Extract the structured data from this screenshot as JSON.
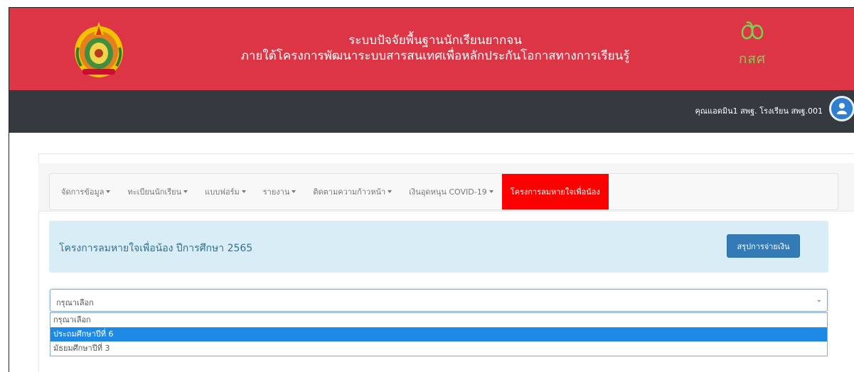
{
  "header": {
    "title_line1": "ระบบปัจจัยพื้นฐานนักเรียนยากจน",
    "title_line2": "ภายใต้โครงการพัฒนาระบบสารสนเทศเพื่อหลักประกันโอกาสทางการเรียนรู้",
    "right_logo_text": "กสศ",
    "right_logo_color": "#7cd04f"
  },
  "topbar": {
    "user_label": "คุณแอดมิน1 สพฐ. โรงเรียน สพฐ.001",
    "avatar_icon": "user-icon"
  },
  "nav": {
    "items": [
      {
        "label": "จัดการข้อมูล",
        "dropdown": true
      },
      {
        "label": "ทะเบียนนักเรียน",
        "dropdown": true
      },
      {
        "label": "แบบฟอร์ม",
        "dropdown": true
      },
      {
        "label": "รายงาน",
        "dropdown": true
      },
      {
        "label": "ติดตามความก้าวหน้า",
        "dropdown": true
      },
      {
        "label": "เงินอุดหนุน COVID-19",
        "dropdown": true
      },
      {
        "label": "โครงการลมหายใจเพื่อน้อง",
        "dropdown": false,
        "active": true
      }
    ]
  },
  "panel": {
    "title": "โครงการลมหายใจเพื่อน้อง ปีการศึกษา 2565",
    "button_label": "สรุปการจ่ายเงิน"
  },
  "select": {
    "value": "กรุณาเลือก",
    "options": [
      "กรุณาเลือก",
      "ประถมศึกษาปีที่ 6",
      "มัธยมศึกษาปีที่ 3"
    ],
    "highlighted_index": 1
  },
  "colors": {
    "header_red": "#dc3545",
    "topbar_dark": "#343a40",
    "active_tab_red": "#ff0000",
    "panel_blue": "#d9edf7",
    "button_blue": "#337ab7",
    "option_highlight": "#1e88e5"
  }
}
